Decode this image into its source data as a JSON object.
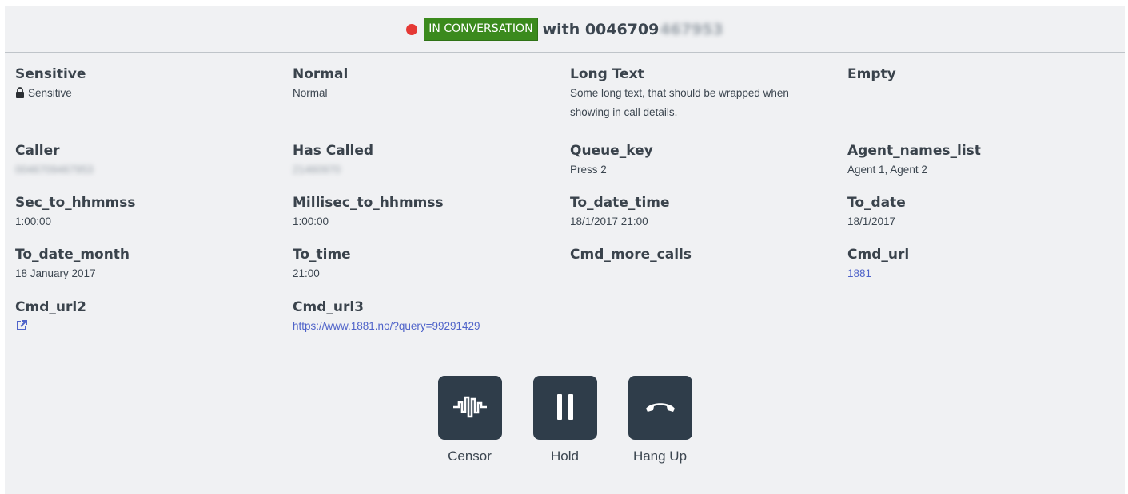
{
  "header": {
    "status": "IN CONVERSATION",
    "with_prefix": "with 0046709",
    "with_hidden": "467953",
    "status_color": "#3b8a1d",
    "dot_color": "#e53935"
  },
  "fields": {
    "sensitive": {
      "label": "Sensitive",
      "value": "Sensitive"
    },
    "normal": {
      "label": "Normal",
      "value": "Normal"
    },
    "long_text": {
      "label": "Long Text",
      "value": "Some long text, that should be wrapped when showing in call details."
    },
    "empty": {
      "label": "Empty"
    },
    "caller": {
      "label": "Caller",
      "value": "0046709467953"
    },
    "has_called": {
      "label": "Has Called",
      "value": "21460970"
    },
    "queue_key": {
      "label": "Queue_key",
      "value": "Press 2"
    },
    "agent_names_list": {
      "label": "Agent_names_list",
      "value": "Agent 1, Agent 2"
    },
    "sec_to_hhmmss": {
      "label": "Sec_to_hhmmss",
      "value": "1:00:00"
    },
    "millisec_to_hhmmss": {
      "label": "Millisec_to_hhmmss",
      "value": "1:00:00"
    },
    "to_date_time": {
      "label": "To_date_time",
      "value": "18/1/2017 21:00"
    },
    "to_date": {
      "label": "To_date",
      "value": "18/1/2017"
    },
    "to_date_month": {
      "label": "To_date_month",
      "value": "18 January 2017"
    },
    "to_time": {
      "label": "To_time",
      "value": "21:00"
    },
    "cmd_more_calls": {
      "label": "Cmd_more_calls"
    },
    "cmd_url": {
      "label": "Cmd_url",
      "value": "1881"
    },
    "cmd_url2": {
      "label": "Cmd_url2",
      "icon": "external-link-icon"
    },
    "cmd_url3": {
      "label": "Cmd_url3",
      "value": "https://www.1881.no/?query=99291429"
    }
  },
  "controls": {
    "censor": {
      "label": "Censor",
      "icon": "waveform-icon"
    },
    "hold": {
      "label": "Hold",
      "icon": "pause-icon"
    },
    "hang_up": {
      "label": "Hang Up",
      "icon": "phone-hangup-icon"
    }
  },
  "colors": {
    "link": "#4f63c9",
    "button_bg": "#2f3d4a",
    "panel_bg": "#f0f1f3"
  }
}
